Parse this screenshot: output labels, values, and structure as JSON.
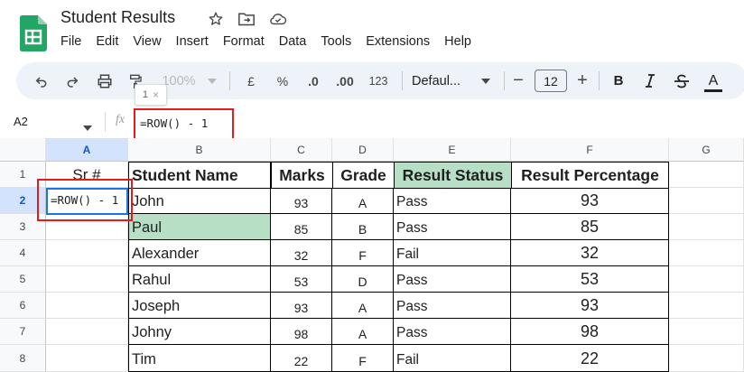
{
  "app": {
    "doc_title": "Student Results",
    "menu": [
      "File",
      "Edit",
      "View",
      "Insert",
      "Format",
      "Data",
      "Tools",
      "Extensions",
      "Help"
    ]
  },
  "toolbar": {
    "zoom": "100%",
    "currency": "£",
    "percent": "%",
    "dec_decrease": ".0",
    "dec_increase": ".00",
    "number_format": "123",
    "font_name": "Defaul...",
    "font_size": "12",
    "minus": "−",
    "plus": "+",
    "bold": "B",
    "text_color": "A",
    "icons": [
      "undo-icon",
      "redo-icon",
      "print-icon",
      "paint-format-icon",
      "currency-icon",
      "percent-icon",
      "decrease-decimal-icon",
      "increase-decimal-icon",
      "number-format-icon",
      "font-size-decrease-icon",
      "font-size-increase-icon",
      "bold-icon",
      "italic-icon",
      "strikethrough-icon",
      "text-color-icon"
    ]
  },
  "tooltip": {
    "text": "1",
    "close": "×"
  },
  "formula_bar": {
    "name_box": "A2",
    "fx": "fx",
    "formula": "=ROW() - 1"
  },
  "colors": {
    "accent": "#1a73e8",
    "highlight_red": "#e21c1c",
    "green_fill": "#b7dfc6",
    "header_selected": "#d3e3fd"
  },
  "grid": {
    "columns": [
      "A",
      "B",
      "C",
      "D",
      "E",
      "F",
      "G"
    ],
    "rows": [
      "1",
      "2",
      "3",
      "4",
      "5",
      "6",
      "7",
      "8"
    ],
    "active_cell": "=ROW() - 1",
    "header": {
      "sr": "Sr #",
      "name": "Student  Name",
      "marks": "Marks",
      "grade": "Grade",
      "status": "Result Status",
      "pct": "Result Percentage"
    },
    "data": [
      {
        "name": "John",
        "marks": "93",
        "grade": "A",
        "status": "Pass",
        "pct": "93"
      },
      {
        "name": "Paul",
        "marks": "85",
        "grade": "B",
        "status": "Pass",
        "pct": "85"
      },
      {
        "name": "Alexander",
        "marks": "32",
        "grade": "F",
        "status": "Fail",
        "pct": "32"
      },
      {
        "name": "Rahul",
        "marks": "53",
        "grade": "D",
        "status": "Pass",
        "pct": "53"
      },
      {
        "name": "Joseph",
        "marks": "93",
        "grade": "A",
        "status": "Pass",
        "pct": "93"
      },
      {
        "name": "Johny",
        "marks": "98",
        "grade": "A",
        "status": "Pass",
        "pct": "98"
      },
      {
        "name": "Tim",
        "marks": "22",
        "grade": "F",
        "status": "Fail",
        "pct": "22"
      }
    ]
  }
}
